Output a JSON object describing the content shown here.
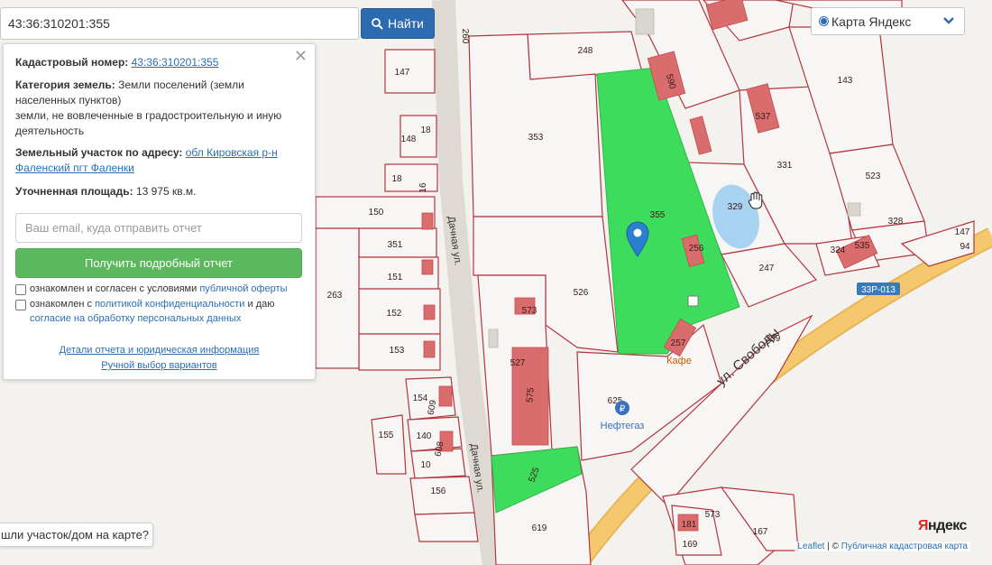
{
  "search": {
    "value": "43:36:310201:355",
    "button_label": "Найти"
  },
  "info_panel": {
    "cadastral_label": "Кадастровый номер:",
    "cadastral_value": "43:36:310201:355",
    "category_label": "Категория земель:",
    "category_line1": "Земли поселений (земли населенных пунктов)",
    "category_line2": "земли, не вовлеченные в градостроительную и иную деятельность",
    "address_label": "Земельный участок по адресу:",
    "address_value": "обл Кировская р-н Фаленский пгт Фаленки",
    "area_label": "Уточненная площадь:",
    "area_value": "13 975 кв.м.",
    "email_placeholder": "Ваш email, куда отправить отчет",
    "report_button": "Получить подробный отчет",
    "consent1_text": "ознакомлен и согласен с условиями",
    "consent1_link": "публичной оферты",
    "consent2_text": "ознакомлен с",
    "consent2_link": "политикой конфиденциальности",
    "consent2_mid": "и даю",
    "consent2_link2": "согласие на обработку персональных данных",
    "details_link": "Детали отчета и юридическая информация",
    "manual_link": "Ручной выбор вариантов"
  },
  "layer_select": {
    "selected": "Карта Яндекс"
  },
  "help_button": "шли участок/дом на карте?",
  "attribution": {
    "leaflet": "Leaflet",
    "sep": "|",
    "copyright": "©",
    "cadastral": "Публичная кадастровая карта"
  },
  "logo": {
    "first": "Я",
    "rest": "ндекс"
  },
  "map": {
    "parcel_labels": [
      "147",
      "148",
      "18",
      "150",
      "351",
      "151",
      "152",
      "153",
      "154",
      "140",
      "10",
      "156",
      "155",
      "263",
      "248",
      "353",
      "355",
      "526",
      "573",
      "527",
      "625",
      "619",
      "143",
      "537",
      "331",
      "523",
      "329",
      "328",
      "324",
      "535",
      "247",
      "256",
      "257",
      "239",
      "147",
      "94",
      "573",
      "167",
      "169",
      "181",
      "18",
      "16",
      "260",
      "609",
      "575",
      "590",
      "608",
      "525"
    ],
    "streets": {
      "dachnaya1": "Дачная ул.",
      "dachnaya2": "Дачная ул.",
      "svobody": "ул. Свободы"
    },
    "road_badge": "33Р-013",
    "poi_cafe": "Кафе",
    "poi_fuel": "Нефтегаз",
    "highlight_color": "#3ddc5c",
    "parcel_border_color": "#b5343e",
    "building_color": "#d96d6d",
    "pond_color": "#a7d3f0",
    "road_color": "#f5c86e"
  },
  "colors": {
    "find_button": "#2d6bb0",
    "report_button": "#5cb85c",
    "link": "#2a6fb5"
  }
}
